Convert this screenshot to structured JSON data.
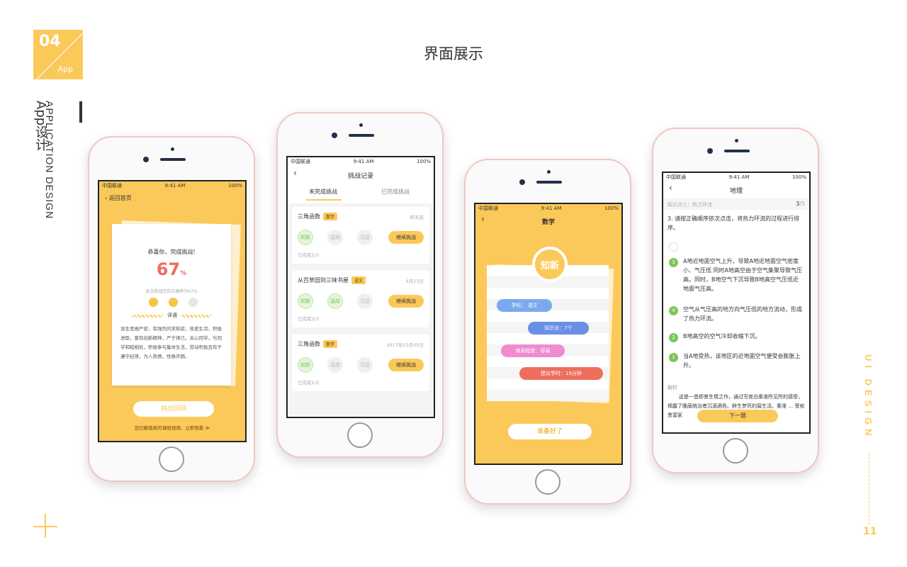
{
  "badge": {
    "num": "04",
    "label": "App"
  },
  "side": {
    "en": "APPLICATION DESIGN",
    "cn": "App设计"
  },
  "title": "界面展示",
  "ui_design": "UI DESIGN",
  "page_number": "11",
  "colors": {
    "accent": "#fbc95a",
    "green": "#7cc65a",
    "red": "#ee6e5c",
    "blue": "#6a8fe6",
    "pink": "#f08bd0"
  },
  "phone1": {
    "status": {
      "carrier": "中国联通",
      "time": "9:41 AM",
      "battery": "100%"
    },
    "back": "返回首页",
    "congrats": "恭喜你，完成挑战!",
    "percent": "67",
    "percent_unit": "%",
    "accuracy_note": "本次挑战您的正确率为67%",
    "comment_title": "评语",
    "comment_text": "该生思维严密，有强烈的求知欲，热爱生活，积极进取，富有创新精神，严于律己，关心同学，与同学和睦相处，积极参与集体生活，劳动积极且有干遵守纪律，为人热情，性格开朗。",
    "review_button": "挑战回顾",
    "footer": "您已解锁新的课程视频，立即观看 ≫"
  },
  "phone2": {
    "status": {
      "carrier": "中国联通",
      "time": "9:41 AM",
      "battery": "100%"
    },
    "title": "挑战记录",
    "tabs": [
      "未完成挑战",
      "已完成挑战"
    ],
    "cards": [
      {
        "name": "三角函数",
        "tag": "数学",
        "date": "昨天前",
        "steps": [
          "知新",
          "温故",
          "沉淀"
        ],
        "done": 1,
        "button": "继续挑战",
        "progress": "已完成1/3"
      },
      {
        "name": "从百草园到三味书屋",
        "tag": "语文",
        "date": "6月13日",
        "steps": [
          "知新",
          "温故",
          "沉淀"
        ],
        "done": 2,
        "button": "继续挑战",
        "progress": "已完成2/3"
      },
      {
        "name": "三角函数",
        "tag": "数学",
        "date": "2017年03月05日",
        "steps": [
          "知新",
          "温故",
          "沉淀"
        ],
        "done": 1,
        "button": "继续挑战",
        "progress": "已完成1/3"
      }
    ]
  },
  "phone3": {
    "status": {
      "carrier": "中国联通",
      "time": "9:41 AM",
      "battery": "100%"
    },
    "title": "数学",
    "badge": "知新",
    "pills": [
      "学科： 语文",
      "知识点：7个",
      "难易程度：容易",
      "建议学时：15分钟"
    ],
    "ready_button": "准备好了"
  },
  "phone4": {
    "status": {
      "carrier": "中国联通",
      "time": "9:41 AM",
      "battery": "100%"
    },
    "title": "地理",
    "knowledge": "知识点三：热力环流",
    "page": "3",
    "page_total": "/5",
    "question": "3. 请按正确顺序依次点击，将热力环流的过程进行排序。",
    "options": [
      {
        "n": "3",
        "text": "A地近地面空气上升，导致A地近地面空气密度小、气压低 同时A地高空由于空气集聚导致气压高。同时，B地空气下沉导致B地高空气压低近地面气压高。"
      },
      {
        "n": "4",
        "text": "空气从气压高的地方向气压低的地方流动，形成了热力环流。"
      },
      {
        "n": "2",
        "text": "B地高空的空气冷却收缩下沉。"
      },
      {
        "n": "1",
        "text": "当A地受热，该地区的近地面空气便受会膨胀上升。"
      }
    ],
    "analysis_title": "解析",
    "analysis_text": "这是一首即景生情之作，通过写夜泊秦淮所见所的感受，揭露了晚唐统治者沉湎酒色、醉生梦死的腐生活。秦淮 … 受权贵富家",
    "next_button": "下一题"
  }
}
